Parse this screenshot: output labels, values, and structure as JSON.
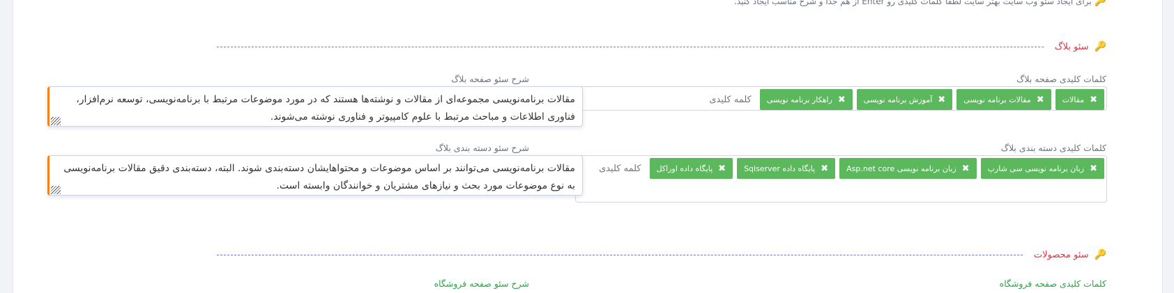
{
  "hint": {
    "text": "برای ایجاد سئو وب سایت بهتر سایت لطفا کلمات کلیدی رو Enter از هم جدا و شرح مناسب ایجاد کنید."
  },
  "sections": {
    "blog": {
      "title": "سئو بلاگ"
    },
    "products": {
      "title": "سئو محصولات"
    }
  },
  "blog_page": {
    "keywords_label": "کلمات کلیدی صفحه بلاگ",
    "description_label": "شرح سئو صفحه بلاگ",
    "tags": [
      "مقالات",
      "مقالات برنامه نویسی",
      "آموزش برنامه نویسی",
      "راهکار برنامه نویسی"
    ],
    "keyword_placeholder": "کلمه کلیدی",
    "description": "مقالات برنامه‌نویسی مجموعه‌ای از مقالات و نوشته‌ها هستند که در مورد موضوعات مرتبط با برنامه‌نویسی، توسعه نرم‌افزار، فناوری اطلاعات و مباحث مرتبط با علوم کامپیوتر و فناوری نوشته می‌شوند."
  },
  "blog_category": {
    "keywords_label": "کلمات کلیدی دسته بندی بلاگ",
    "description_label": "شرح سئو دسته بندی بلاگ",
    "tags": [
      "زبان برنامه نویسی سی شارپ",
      "زبان برنامه نویسی Asp.net core",
      "پایگاه داده Sqlserver",
      "پایگاه داده اوراکل"
    ],
    "keyword_placeholder": "کلمه کلیدی",
    "description": "مقالات برنامه‌نویسی می‌توانند بر اساس موضوعات و محتواهایشان دسته‌بندی شوند. البته، دسته‌بندی دقیق مقالات برنامه‌نویسی به نوع موضوعات مورد بحث و نیازهای مشتریان و خوانندگان وابسته است."
  },
  "shop_page": {
    "keywords_label": "کلمات کلیدی صفحه فروشگاه",
    "description_label": "شرح سئو صفحه فروشگاه"
  },
  "colors": {
    "accent_red": "#dc3545",
    "tag_green": "#5cb85c",
    "label_green": "#28a745",
    "textarea_accent": "#fd7e14"
  },
  "icons": {
    "section": "key-icon",
    "tag_remove": "close-icon"
  }
}
